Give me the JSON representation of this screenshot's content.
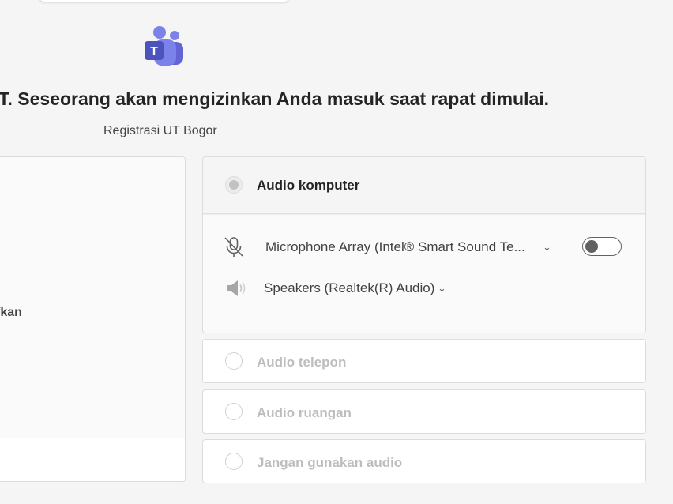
{
  "page": {
    "headline": "T. Seseorang akan mengizinkan Anda masuk saat rapat dimulai.",
    "meeting_name": "Registrasi UT Bogor"
  },
  "left_panel": {
    "partial_text": "fkan"
  },
  "audio_options": {
    "computer": {
      "label": "Audio komputer",
      "selected": true,
      "microphone": {
        "device": "Microphone Array (Intel® Smart Sound Te...",
        "icon": "mic-off-icon",
        "toggle_on": false
      },
      "speakers": {
        "device": "Speakers (Realtek(R) Audio)",
        "icon": "speaker-icon"
      }
    },
    "phone": {
      "label": "Audio telepon",
      "selected": false
    },
    "room": {
      "label": "Audio ruangan",
      "selected": false
    },
    "none": {
      "label": "Jangan gunakan audio",
      "selected": false
    }
  },
  "icons": {
    "chevron": "chevron-down-icon",
    "logo": "teams-logo"
  },
  "colors": {
    "brand_purple": "#5b5fc7",
    "disabled_text": "#bdbdbd",
    "background": "#f5f5f5"
  }
}
